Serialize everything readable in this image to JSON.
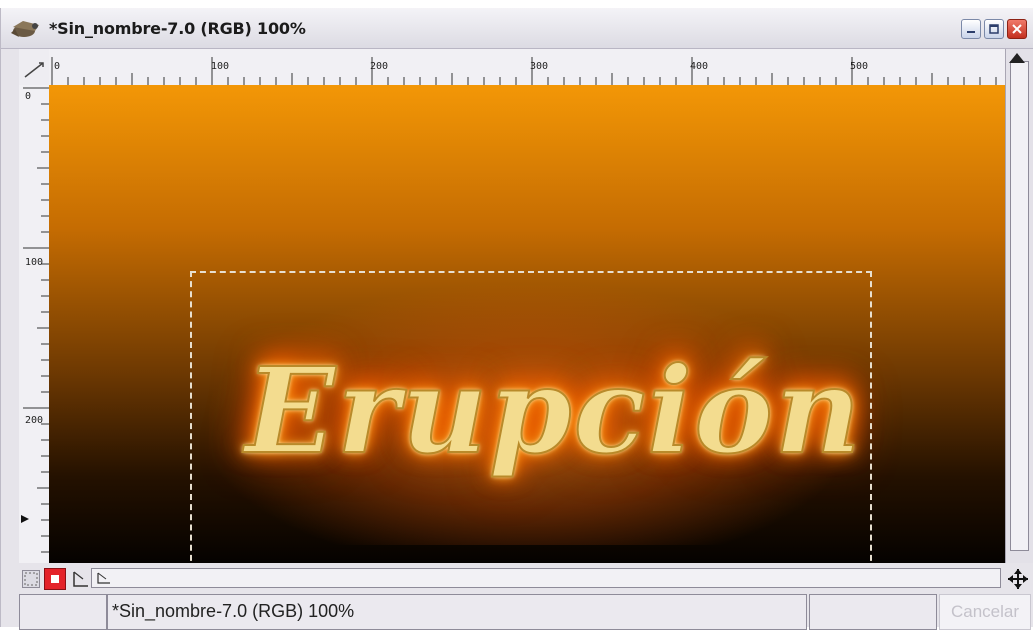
{
  "window": {
    "title": "*Sin_nombre-7.0 (RGB) 100%",
    "app_icon": "gimp-wilber-icon",
    "controls": {
      "minimize": "minimize-icon",
      "maximize": "maximize-icon",
      "close": "close-icon"
    }
  },
  "rulers": {
    "horizontal_labels": [
      "0",
      "100",
      "200",
      "300",
      "400",
      "500"
    ],
    "vertical_labels": [
      "0",
      "100",
      "200"
    ]
  },
  "canvas": {
    "artwork_text": "Erupción",
    "gradient_top": "#f39706",
    "gradient_bottom": "#050200",
    "has_selection": true
  },
  "statusbar": {
    "image_info": "*Sin_nombre-7.0 (RGB) 100%",
    "cancel_label": "Cancelar"
  },
  "icons": {
    "quick_mask": "quick-mask-icon",
    "navigate": "navigate-icon",
    "move": "move-icon"
  }
}
